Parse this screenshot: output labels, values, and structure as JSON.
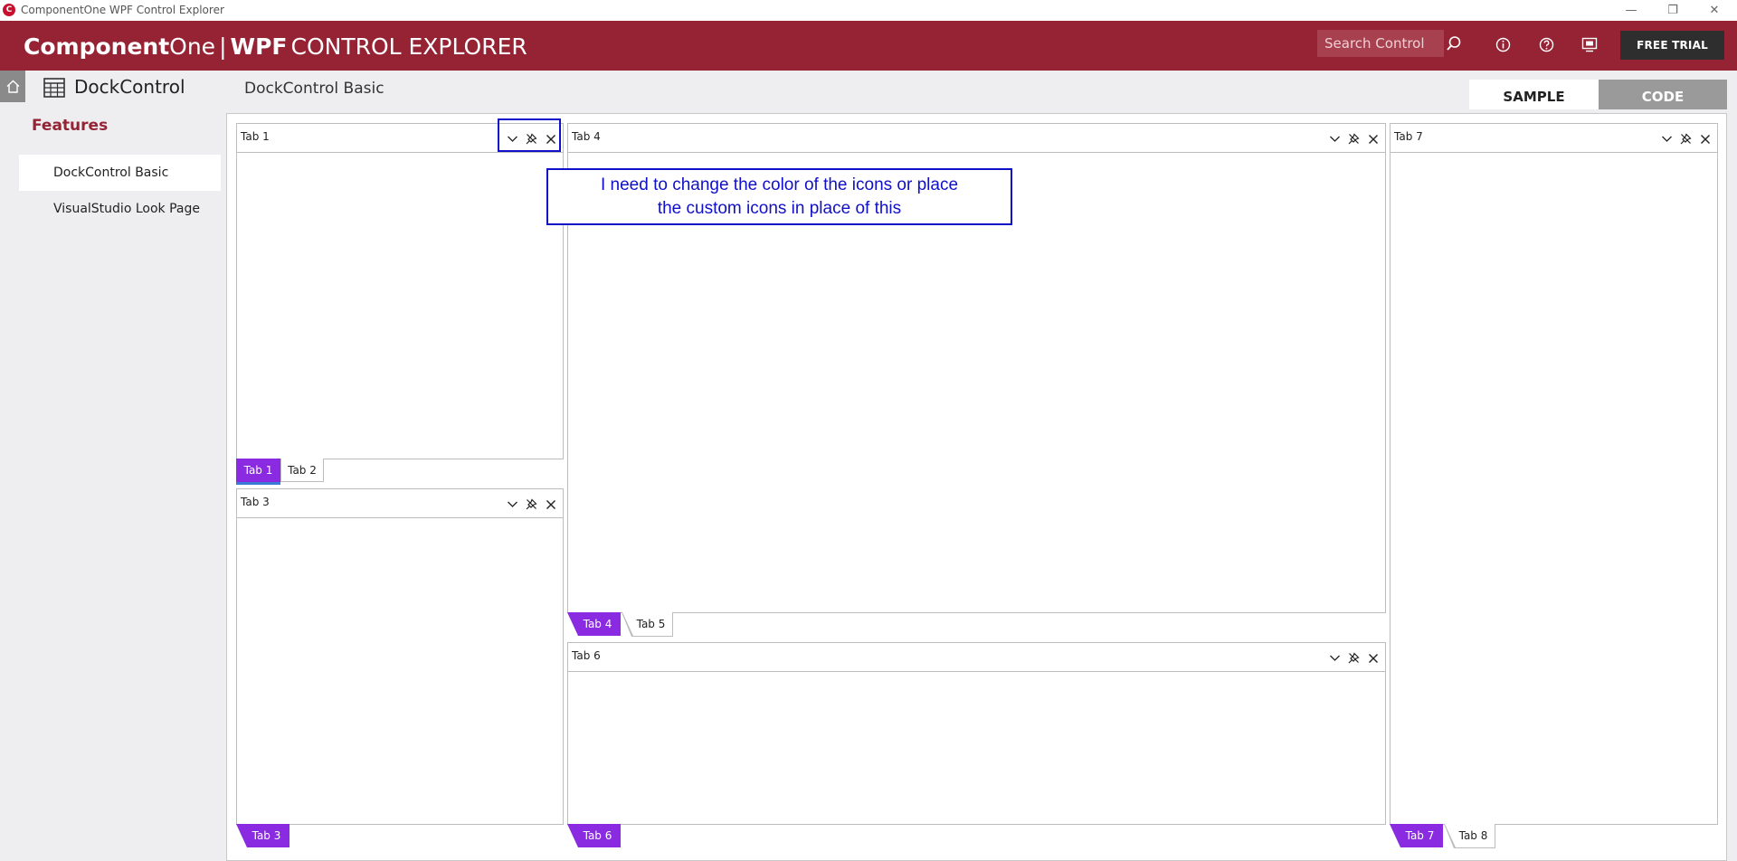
{
  "window": {
    "title": "ComponentOne WPF Control Explorer",
    "app_icon_letter": "C",
    "minimize_glyph": "—",
    "restore_glyph": "❐",
    "close_glyph": "✕"
  },
  "header": {
    "brand_part1": "Component",
    "brand_part2": "One",
    "brand_separator": "|",
    "brand_part3": "WPF",
    "brand_part4": "CONTROL EXPLORER",
    "search_placeholder": "Search Control",
    "free_trial_label": "FREE TRIAL",
    "background_color": "#952334"
  },
  "subheader": {
    "control_name": "DockControl",
    "page_title": "DockControl Basic",
    "sample_tab": "SAMPLE",
    "code_tab": "CODE"
  },
  "sidebar": {
    "features_title": "Features",
    "items": [
      {
        "label": "DockControl Basic",
        "active": true
      },
      {
        "label": "VisualStudio Look Page",
        "active": false
      }
    ]
  },
  "panes": {
    "pane1": {
      "title": "Tab 1",
      "tabs": [
        "Tab 1",
        "Tab 2"
      ]
    },
    "pane3": {
      "title": "Tab 3",
      "tabs": [
        "Tab 3"
      ]
    },
    "pane4": {
      "title": "Tab 4",
      "tabs": [
        "Tab 4",
        "Tab 5"
      ]
    },
    "pane6": {
      "title": "Tab 6",
      "tabs": [
        "Tab 6"
      ]
    },
    "pane7": {
      "title": "Tab 7",
      "tabs": [
        "Tab 7",
        "Tab 8"
      ]
    }
  },
  "annotation": {
    "line1": "I need to change the color of the icons or place",
    "line2": "the custom icons in place of this"
  },
  "colors": {
    "accent_tab": "#8a2be2",
    "annotation": "#1010c8",
    "brand": "#952334"
  }
}
